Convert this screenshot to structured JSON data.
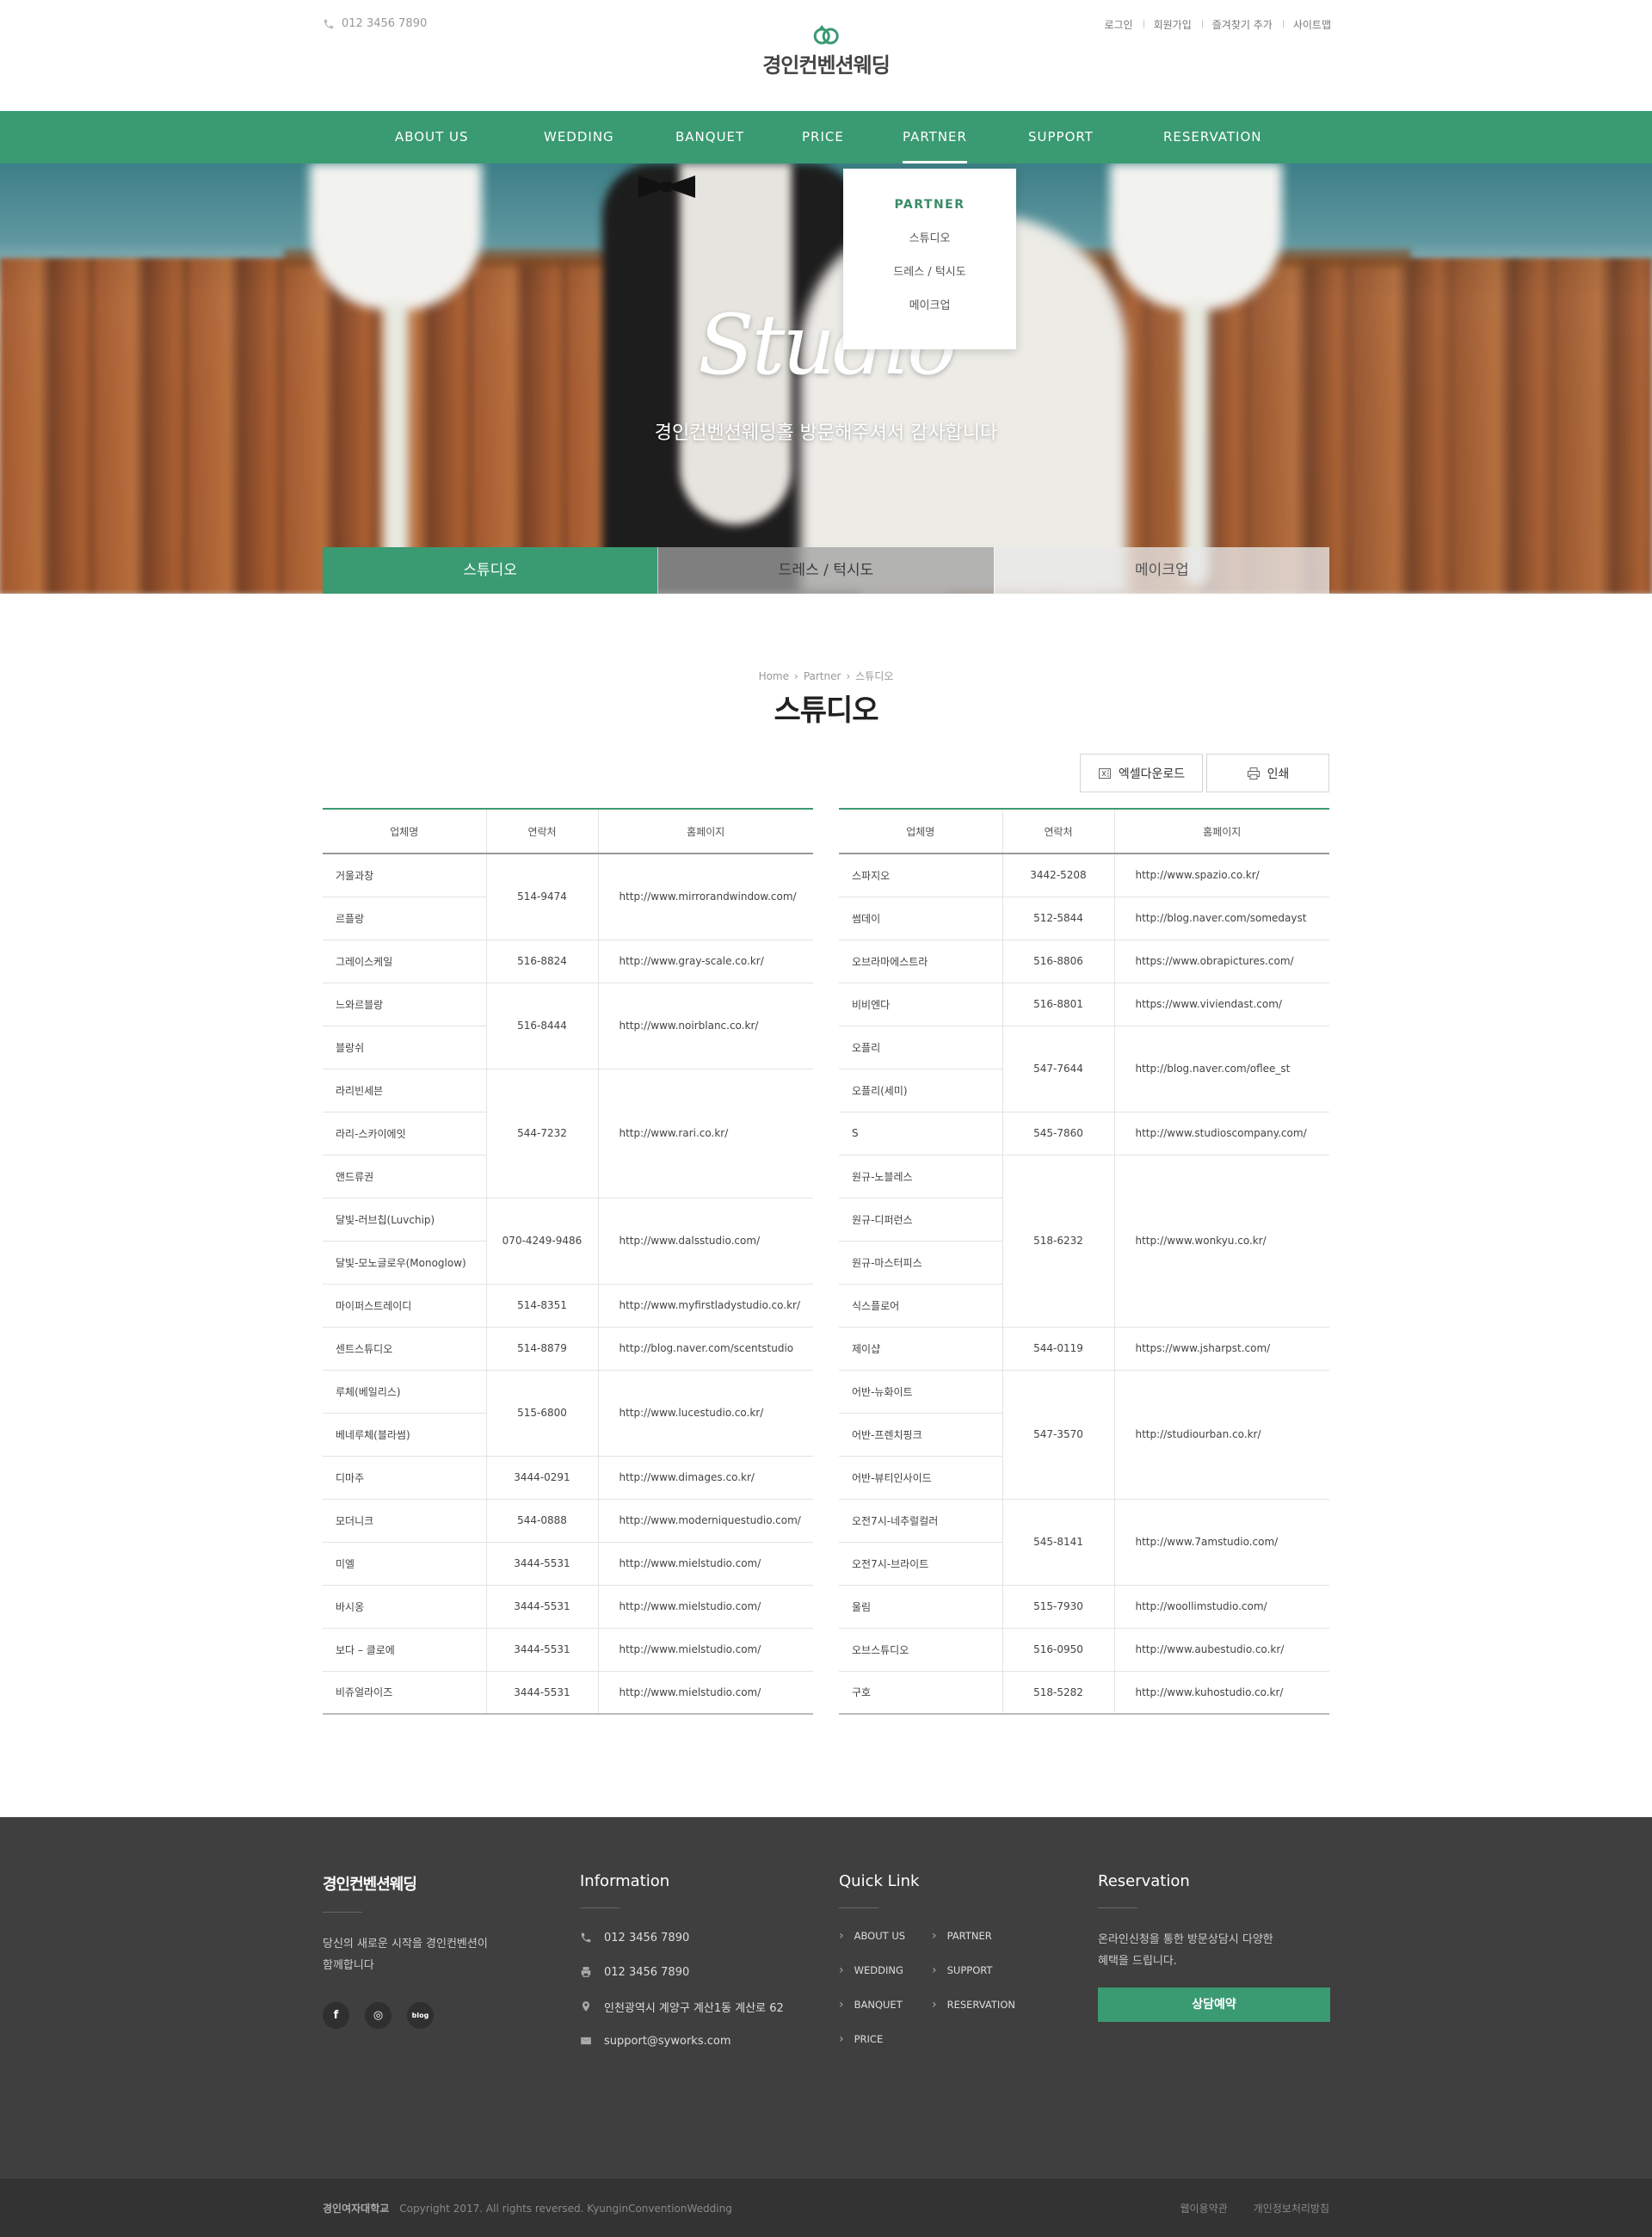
{
  "header": {
    "phone": "012 3456 7890",
    "logo_text": "경인컨벤션웨딩",
    "util_links": [
      "로그인",
      "회원가입",
      "즐겨찾기 추가",
      "사이트맵"
    ]
  },
  "gnb": [
    "ABOUT US",
    "WEDDING",
    "BANQUET",
    "PRICE",
    "PARTNER",
    "SUPPORT",
    "RESERVATION"
  ],
  "dropdown": {
    "title": "PARTNER",
    "items": [
      "스튜디오",
      "드레스 / 턱시도",
      "메이크업"
    ]
  },
  "hero": {
    "script_title": "Studio",
    "subtitle": "경인컨벤션웨딩홀 방문해주셔서 감사합니다",
    "tabs": [
      "스튜디오",
      "드레스 / 턱시도",
      "메이크업"
    ]
  },
  "breadcrumb": {
    "home": "Home",
    "section": "Partner",
    "current": "스튜디오"
  },
  "page_title": "스튜디오",
  "buttons": {
    "excel": "엑셀다운로드",
    "print": "인쇄"
  },
  "table_headers": [
    "업체명",
    "연락처",
    "홈페이지"
  ],
  "left_table": [
    {
      "names": [
        "거울과창",
        "르플랑"
      ],
      "phone": "514-9474",
      "url": "http://www.mirrorandwindow.com/"
    },
    {
      "names": [
        "그레이스케일"
      ],
      "phone": "516-8824",
      "url": "http://www.gray-scale.co.kr/"
    },
    {
      "names": [
        "느와르블랑",
        "블랑쉬"
      ],
      "phone": "516-8444",
      "url": "http://www.noirblanc.co.kr/"
    },
    {
      "names": [
        "라리빈세븐",
        "라리-스카이에잇",
        "앤드류권"
      ],
      "phone": "544-7232",
      "url": "http://www.rari.co.kr/"
    },
    {
      "names": [
        "달빛-러브칩(Luvchip)",
        "달빛-모노글로우(Monoglow)"
      ],
      "phone": "070-4249-9486",
      "url": "http://www.dalsstudio.com/"
    },
    {
      "names": [
        "마이퍼스트레이디"
      ],
      "phone": "514-8351",
      "url": "http://www.myfirstladystudio.co.kr/"
    },
    {
      "names": [
        "센트스튜디오"
      ],
      "phone": "514-8879",
      "url": "http://blog.naver.com/scentstudio"
    },
    {
      "names": [
        "루체(베일리스)",
        "베네루체(블라썸)"
      ],
      "phone": "515-6800",
      "url": "http://www.lucestudio.co.kr/"
    },
    {
      "names": [
        "디마주"
      ],
      "phone": "3444-0291",
      "url": "http://www.dimages.co.kr/"
    },
    {
      "names": [
        "모더니크"
      ],
      "phone": "544-0888",
      "url": "http://www.moderniquestudio.com/"
    },
    {
      "names": [
        "미엘"
      ],
      "phone": "3444-5531",
      "url": "http://www.mielstudio.com/"
    },
    {
      "names": [
        "바시옹"
      ],
      "phone": "3444-5531",
      "url": "http://www.mielstudio.com/"
    },
    {
      "names": [
        "보다 – 클로에"
      ],
      "phone": "3444-5531",
      "url": "http://www.mielstudio.com/"
    },
    {
      "names": [
        "비쥬얼라이즈"
      ],
      "phone": "3444-5531",
      "url": "http://www.mielstudio.com/"
    }
  ],
  "right_table": [
    {
      "names": [
        "스파지오"
      ],
      "phone": "3442-5208",
      "url": "http://www.spazio.co.kr/"
    },
    {
      "names": [
        "썸데이"
      ],
      "phone": "512-5844",
      "url": "http://blog.naver.com/somedayst"
    },
    {
      "names": [
        "오브라마에스트라"
      ],
      "phone": "516-8806",
      "url": "https://www.obrapictures.com/"
    },
    {
      "names": [
        "비비엔다"
      ],
      "phone": "516-8801",
      "url": "https://www.viviendast.com/"
    },
    {
      "names": [
        "오플리",
        "오플리(세미)"
      ],
      "phone": "547-7644",
      "url": "http://blog.naver.com/oflee_st"
    },
    {
      "names": [
        "S"
      ],
      "phone": "545-7860",
      "url": "http://www.studioscompany.com/"
    },
    {
      "names": [
        "원규-노블레스",
        "원규-디퍼런스",
        "원규-마스터피스",
        "식스플로어"
      ],
      "phone": "518-6232",
      "url": "http://www.wonkyu.co.kr/"
    },
    {
      "names": [
        "제이샵"
      ],
      "phone": "544-0119",
      "url": "https://www.jsharpst.com/"
    },
    {
      "names": [
        "어반-뉴화이트",
        "어반-프렌치핑크",
        "어반-뷰티인사이드"
      ],
      "phone": "547-3570",
      "url": "http://studiourban.co.kr/"
    },
    {
      "names": [
        "오전7시-네추럴컬러",
        "오전7시-브라이트"
      ],
      "phone": "545-8141",
      "url": "http://www.7amstudio.com/"
    },
    {
      "names": [
        "울림"
      ],
      "phone": "515-7930",
      "url": "http://woollimstudio.com/"
    },
    {
      "names": [
        "오브스튜디오"
      ],
      "phone": "516-0950",
      "url": "http://www.aubestudio.co.kr/"
    },
    {
      "names": [
        "구호"
      ],
      "phone": "518-5282",
      "url": "http://www.kuhostudio.co.kr/"
    }
  ],
  "footer": {
    "brand": "경인컨벤션웨딩",
    "brand_desc_1": "당신의 새로운 시작을 경인컨벤션이",
    "brand_desc_2": "함께합니다",
    "sns": [
      "f",
      "◎",
      "blog"
    ],
    "info_title": "Information",
    "tel": "012 3456 7890",
    "fax": "012 3456 7890",
    "address": "인천광역시 계양구 계산1동 계산로 62",
    "email": "support@syworks.com",
    "quick_title": "Quick Link",
    "quick_links": [
      "ABOUT US",
      "PARTNER",
      "WEDDING",
      "SUPPORT",
      "BANQUET",
      "RESERVATION",
      "PRICE"
    ],
    "reserve_title": "Reservation",
    "reserve_desc_1": "온라인신청을 통한 방문상담시 다양한",
    "reserve_desc_2": "혜택을 드립니다.",
    "reserve_button": "상담예약",
    "bottom_logo": "경인여자대학교",
    "copyright": "Copyright 2017. All rights reversed. KyunginConventionWedding",
    "bottom_links": [
      "웹이용약관",
      "개인정보처리방침"
    ]
  }
}
